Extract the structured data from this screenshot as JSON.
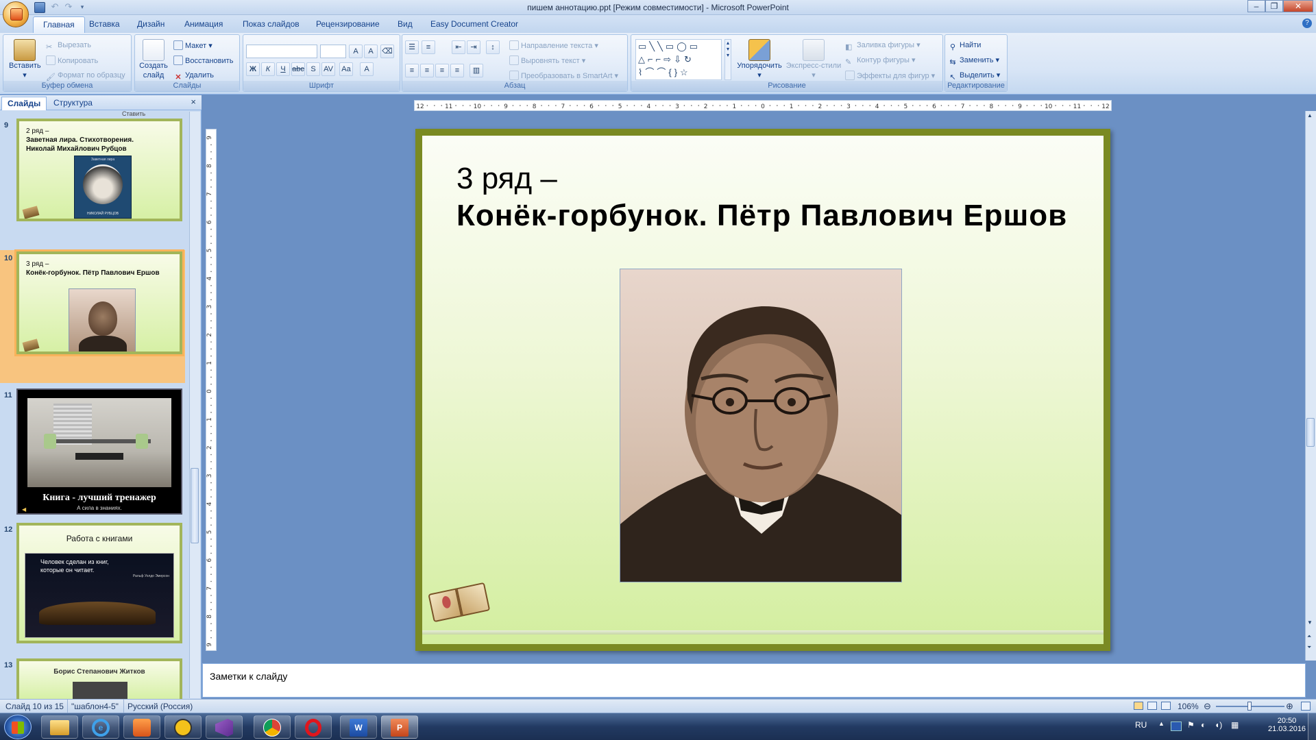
{
  "window": {
    "title": "пишем аннотацию.ppt [Режим совместимости] - Microsoft PowerPoint"
  },
  "tabs": [
    "Главная",
    "Вставка",
    "Дизайн",
    "Анимация",
    "Показ слайдов",
    "Рецензирование",
    "Вид",
    "Easy Document Creator"
  ],
  "ribbon": {
    "clipboard": {
      "label": "Буфер обмена",
      "paste": "Вставить",
      "cut": "Вырезать",
      "copy": "Копировать",
      "format_painter": "Формат по образцу"
    },
    "slides": {
      "label": "Слайды",
      "new_slide_1": "Создать",
      "new_slide_2": "слайд",
      "layout": "Макет",
      "reset": "Восстановить",
      "delete": "Удалить"
    },
    "font": {
      "label": "Шрифт"
    },
    "paragraph": {
      "label": "Абзац",
      "text_direction": "Направление текста",
      "align_text": "Выровнять текст",
      "smartart": "Преобразовать в SmartArt"
    },
    "drawing": {
      "label": "Рисование",
      "arrange": "Упорядочить",
      "quick_styles": "Экспресс-стили",
      "fill": "Заливка фигуры",
      "outline": "Контур фигуры",
      "effects": "Эффекты для фигур"
    },
    "editing": {
      "label": "Редактирование",
      "find": "Найти",
      "replace": "Заменить",
      "select": "Выделить"
    }
  },
  "pane": {
    "tab_slides": "Слайды",
    "tab_outline": "Структура",
    "close": "×",
    "top_cut_text": "Ставить",
    "thumbs": {
      "t9": {
        "num": "9",
        "line1": "2 ряд –",
        "line2": "Заветная лира. Стихотворения.",
        "line3": "Николай Михайлович Рубцов",
        "book_title": "Заветная лира",
        "book_author": "НИКОЛАЙ РУБЦОВ"
      },
      "t10": {
        "num": "10",
        "line1": "3 ряд –",
        "line2": "Конёк-горбунок. Пётр Павлович Ершов"
      },
      "t11": {
        "num": "11",
        "caption": "Книга - лучший тренажер",
        "sub": "А сила в знаниях."
      },
      "t12": {
        "num": "12",
        "title": "Работа с   книгами",
        "quote1": "Человек сделан из книг,",
        "quote2": "которые он читает.",
        "quote_author": "Ральф Уолдо Эмерсон"
      },
      "t13": {
        "num": "13",
        "title": "Борис Степанович Житков"
      }
    }
  },
  "ruler": {
    "h_ticks": [
      "12",
      "11",
      "10",
      "9",
      "8",
      "7",
      "6",
      "5",
      "4",
      "3",
      "2",
      "1",
      "0",
      "1",
      "2",
      "3",
      "4",
      "5",
      "6",
      "7",
      "8",
      "9",
      "10",
      "11",
      "12"
    ],
    "v_ticks": [
      "9",
      "8",
      "7",
      "6",
      "5",
      "4",
      "3",
      "2",
      "1",
      "0",
      "1",
      "2",
      "3",
      "4",
      "5",
      "6",
      "7",
      "8",
      "9"
    ]
  },
  "slide": {
    "line1": "3 ряд –",
    "line2": "Конёк-горбунок. Пётр Павлович Ершов"
  },
  "notes": {
    "placeholder": "Заметки к слайду"
  },
  "status": {
    "slide_counter": "Слайд 10 из 15",
    "theme": "\"шаблон4-5\"",
    "language": "Русский (Россия)",
    "zoom": "106%"
  },
  "taskbar": {
    "lang": "RU",
    "time": "20:50",
    "date": "21.03.2016"
  },
  "colors": {
    "ribbon_blue": "#15428b",
    "slide_frame": "#7a8a23",
    "selection_orange": "#f8b35b"
  }
}
